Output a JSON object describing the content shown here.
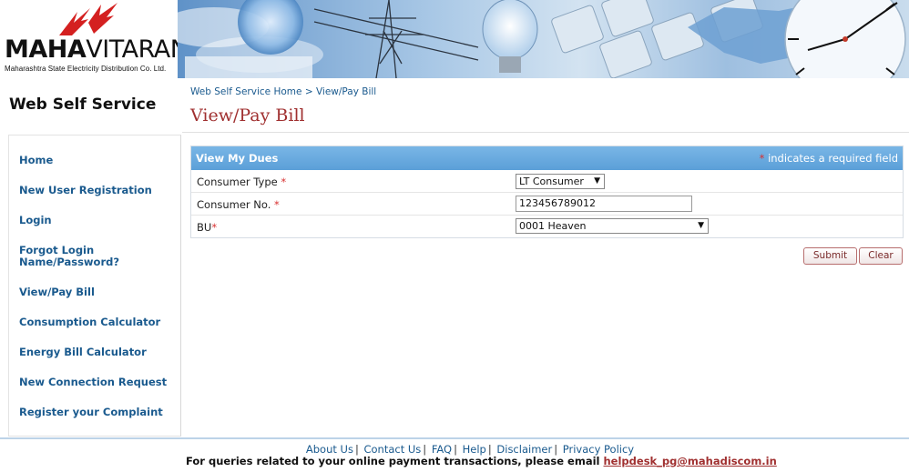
{
  "header": {
    "brand_maha": "MAHA",
    "brand_vitaran": "VITARAN",
    "brand_subtitle": "Maharashtra State Electricity Distribution Co. Ltd."
  },
  "sidebar": {
    "title": "Web Self Service",
    "items": [
      {
        "label": "Home"
      },
      {
        "label": "New User Registration"
      },
      {
        "label": "Login"
      },
      {
        "label": "Forgot Login\nName/Password?"
      },
      {
        "label": "View/Pay Bill"
      },
      {
        "label": "Consumption Calculator"
      },
      {
        "label": "Energy Bill Calculator"
      },
      {
        "label": "New Connection Request"
      },
      {
        "label": "Register your Complaint"
      }
    ]
  },
  "breadcrumb": {
    "home": "Web Self Service Home",
    "separator": ">",
    "current": "View/Pay Bill"
  },
  "page": {
    "title": "View/Pay Bill"
  },
  "form": {
    "header_title": "View My Dues",
    "required_marker": "*",
    "required_note": "indicates a required field",
    "fields": {
      "consumer_type": {
        "label": "Consumer Type",
        "marker": "*",
        "value": "LT Consumer"
      },
      "consumer_no": {
        "label": "Consumer No.",
        "marker": "*",
        "value": "123456789012"
      },
      "bu": {
        "label": "BU",
        "marker": "*",
        "value": "0001 Heaven"
      }
    },
    "submit_label": "Submit",
    "clear_label": "Clear"
  },
  "footer": {
    "links": [
      "About Us",
      "Contact Us",
      "FAQ",
      "Help",
      "Disclaimer",
      "Privacy Policy"
    ],
    "separator": "|",
    "note_text": "For queries related to your online payment transactions, please email",
    "email": "helpdesk_pg@mahadiscom.in"
  },
  "colors": {
    "nav_link": "#1a5a8e",
    "title_red": "#a03030",
    "form_header": "#5b9fd8",
    "required": "#d83030"
  }
}
